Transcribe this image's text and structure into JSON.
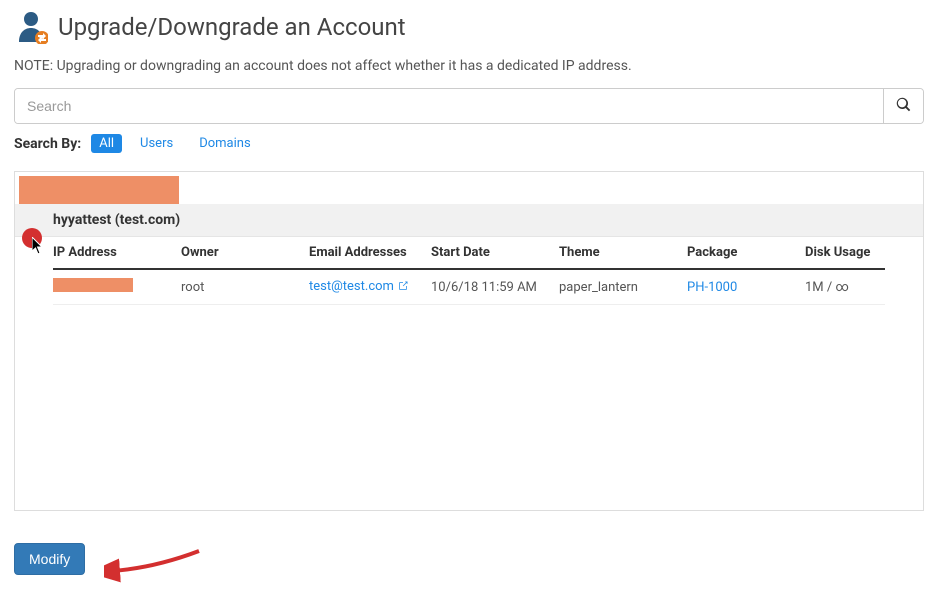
{
  "header": {
    "title": "Upgrade/Downgrade an Account"
  },
  "note": "NOTE: Upgrading or downgrading an account does not affect whether it has a dedicated IP address.",
  "search": {
    "placeholder": "Search"
  },
  "filters": {
    "label": "Search By:",
    "all": "All",
    "users": "Users",
    "domains": "Domains"
  },
  "account": {
    "display": "hyyattest (test.com)"
  },
  "table": {
    "headers": {
      "ip": "IP Address",
      "owner": "Owner",
      "email": "Email Addresses",
      "start": "Start Date",
      "theme": "Theme",
      "package": "Package",
      "disk": "Disk Usage"
    },
    "rows": [
      {
        "owner": "root",
        "email": "test@test.com",
        "start": "10/6/18 11:59 AM",
        "theme": "paper_lantern",
        "package": "PH-1000",
        "disk": "1M / ∞"
      }
    ]
  },
  "buttons": {
    "modify": "Modify"
  }
}
